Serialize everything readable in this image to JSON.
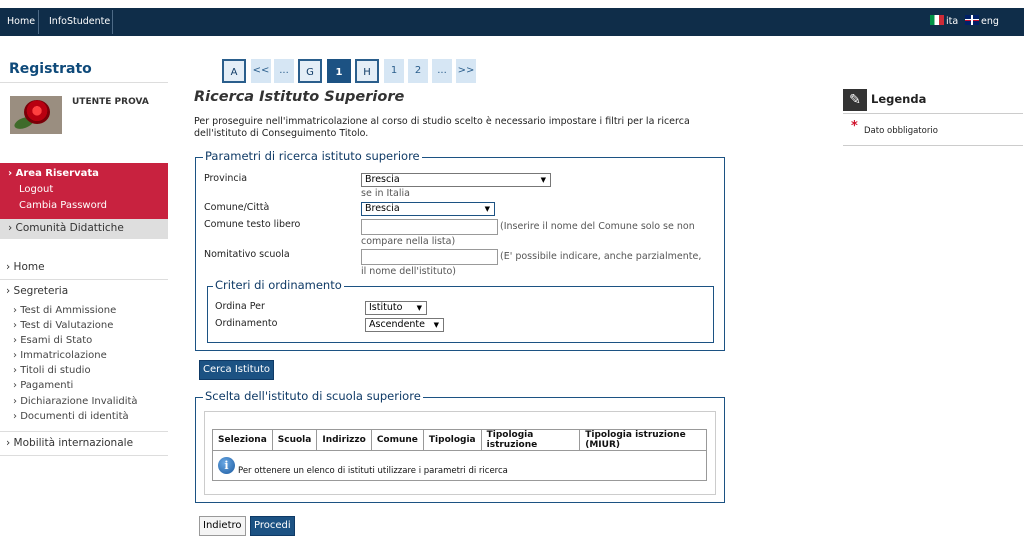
{
  "nav": {
    "home": "Home",
    "infostudente": "InfoStudente",
    "lang_it": "ita",
    "lang_en": "eng"
  },
  "sidebar": {
    "title": "Registrato",
    "user_name": "UTENTE PROVA",
    "area_riservata": "Area Riservata",
    "logout": "Logout",
    "cambia_password": "Cambia Password",
    "comunita": "Comunità Didattiche",
    "home": "Home",
    "segreteria": "Segreteria",
    "segreteria_items": [
      "Test di Ammissione",
      "Test di Valutazione",
      "Esami di Stato",
      "Immatricolazione",
      "Titoli di studio",
      "Pagamenti",
      "Dichiarazione Invalidità",
      "Documenti di identità"
    ],
    "mobilita": "Mobilità internazionale"
  },
  "pager": [
    "A",
    "<<",
    "...",
    "G",
    "1",
    "H",
    "1",
    "2",
    "...",
    ">>"
  ],
  "page": {
    "title": "Ricerca Istituto Superiore",
    "intro": "Per proseguire nell'immatricolazione al corso di studio scelto è necessario impostare i filtri per la ricerca dell'istituto di Conseguimento Titolo."
  },
  "params": {
    "legend": "Parametri di ricerca istituto superiore",
    "provincia_label": "Provincia",
    "provincia_value": "Brescia",
    "provincia_note": "se in Italia",
    "comune_label": "Comune/Città",
    "comune_value": "Brescia",
    "comune_libero_label": "Comune testo libero",
    "comune_libero_value": "",
    "comune_libero_hint1": "(Inserire il nome del Comune solo se non",
    "comune_libero_hint2": "compare nella lista)",
    "nominativo_label": "Nomitativo scuola",
    "nominativo_value": "",
    "nominativo_hint1": "(E' possibile indicare, anche parzialmente,",
    "nominativo_hint2": "il nome dell'istituto)"
  },
  "ordinamento": {
    "legend": "Criteri di ordinamento",
    "ordina_per_label": "Ordina Per",
    "ordina_per_value": "Istituto",
    "ordinamento_label": "Ordinamento",
    "ordinamento_value": "Ascendente"
  },
  "buttons": {
    "cerca": "Cerca Istituto",
    "indietro": "Indietro",
    "procedi": "Procedi"
  },
  "results": {
    "legend": "Scelta dell'istituto di scuola superiore",
    "columns": [
      "Seleziona",
      "Scuola",
      "Indirizzo",
      "Comune",
      "Tipologia",
      "Tipologia istruzione",
      "Tipologia istruzione (MIUR)"
    ],
    "empty_message": "Per ottenere un elenco di istituti utilizzare i parametri di ricerca"
  },
  "legend_panel": {
    "title": "Legenda",
    "required": "Dato obbligatorio"
  },
  "colors": {
    "navy": "#0f2d49",
    "accent_blue": "#1c5283",
    "area_red": "#c8223f"
  },
  "icons": {
    "info": "info-icon",
    "pin": "pin-icon",
    "asterisk": "required-star-icon"
  }
}
